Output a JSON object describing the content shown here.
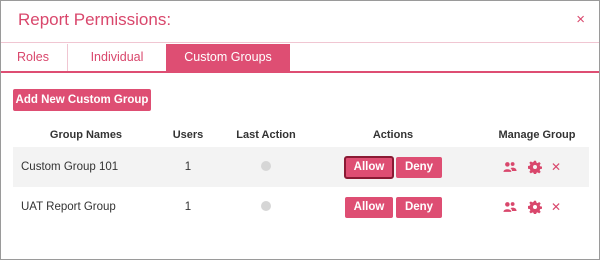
{
  "dialog": {
    "title": "Report Permissions:",
    "close_symbol": "×",
    "accent_color": "#de4e73"
  },
  "tabs": [
    {
      "label": "Roles",
      "active": false
    },
    {
      "label": "Individual",
      "active": false
    },
    {
      "label": "Custom Groups",
      "active": true
    }
  ],
  "toolbar": {
    "add_label": "Add New Custom Group"
  },
  "table": {
    "columns": [
      "Group Names",
      "Users",
      "Last Action",
      "Actions",
      "Manage Group"
    ],
    "rows": [
      {
        "name": "Custom Group 101",
        "users": "1",
        "last_action_icon": "status-dot",
        "allow_label": "Allow",
        "deny_label": "Deny",
        "allow_selected": true,
        "remove_symbol": "✕"
      },
      {
        "name": "UAT Report Group",
        "users": "1",
        "last_action_icon": "status-dot",
        "allow_label": "Allow",
        "deny_label": "Deny",
        "allow_selected": false,
        "remove_symbol": "✕"
      }
    ],
    "manage_icons": [
      "users-group-icon",
      "gear-icon",
      "remove-icon"
    ]
  }
}
